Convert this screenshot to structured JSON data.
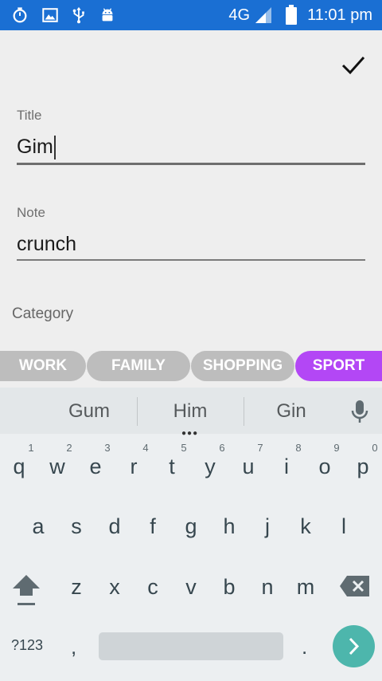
{
  "status_bar": {
    "network": "4G",
    "time": "11:01 pm",
    "icons": [
      "stopwatch-icon",
      "image-icon",
      "usb-icon",
      "android-icon",
      "signal-icon",
      "battery-icon"
    ],
    "background": "#1a6fd3"
  },
  "form": {
    "title_label": "Title",
    "title_value": "Gim",
    "note_label": "Note",
    "note_value": "crunch",
    "category_label": "Category",
    "confirm_icon": "checkmark-icon"
  },
  "categories": {
    "items": [
      "WORK",
      "FAMILY",
      "SHOPPING",
      "SPORT"
    ],
    "selected": "SPORT",
    "selected_color": "#b347f5",
    "unselected_color": "#bdbdbd"
  },
  "keyboard": {
    "suggestions": [
      "Gum",
      "Him",
      "Gin"
    ],
    "row1": [
      "q",
      "w",
      "e",
      "r",
      "t",
      "y",
      "u",
      "i",
      "o",
      "p"
    ],
    "row1_hints": [
      "1",
      "2",
      "3",
      "4",
      "5",
      "6",
      "7",
      "8",
      "9",
      "0"
    ],
    "row2": [
      "a",
      "s",
      "d",
      "f",
      "g",
      "h",
      "j",
      "k",
      "l"
    ],
    "row3": [
      "z",
      "x",
      "c",
      "v",
      "b",
      "n",
      "m"
    ],
    "symbols_label": "?123",
    "comma": ",",
    "period": ".",
    "enter_color": "#4db6ac"
  }
}
